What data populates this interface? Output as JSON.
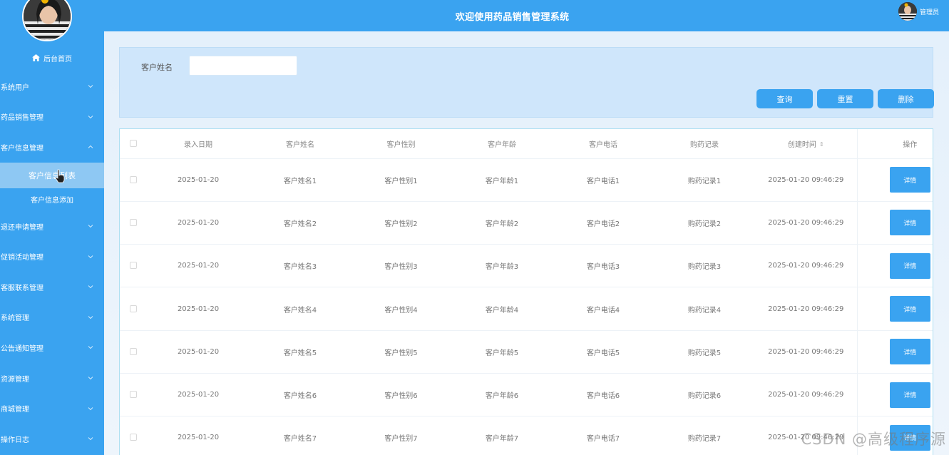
{
  "header": {
    "title": "欢迎使用药品销售管理系统",
    "user_label": "管理员"
  },
  "sidebar": {
    "home_label": "后台首页",
    "items": [
      {
        "label": "系统用户",
        "expanded": false
      },
      {
        "label": "药品销售管理",
        "expanded": false
      },
      {
        "label": "客户信息管理",
        "expanded": true,
        "children": [
          {
            "label": "客户信息列表",
            "active": true
          },
          {
            "label": "客户信息添加",
            "active": false
          }
        ]
      },
      {
        "label": "退还申请管理",
        "expanded": false
      },
      {
        "label": "促销活动管理",
        "expanded": false
      },
      {
        "label": "客服联系管理",
        "expanded": false
      },
      {
        "label": "系统管理",
        "expanded": false
      },
      {
        "label": "公告通知管理",
        "expanded": false
      },
      {
        "label": "资源管理",
        "expanded": false
      },
      {
        "label": "商城管理",
        "expanded": false
      },
      {
        "label": "操作日志",
        "expanded": false
      }
    ]
  },
  "search": {
    "label": "客户姓名",
    "value": "",
    "placeholder": "",
    "query_label": "查询",
    "reset_label": "重置",
    "delete_label": "删除"
  },
  "table": {
    "columns": [
      "录入日期",
      "客户姓名",
      "客户性别",
      "客户年龄",
      "客户电话",
      "购药记录",
      "创建时间",
      "操作"
    ],
    "sort_icon": "sort-icon",
    "action_label": "详情",
    "rows": [
      {
        "date": "2025-01-20",
        "name": "客户姓名1",
        "sex": "客户性别1",
        "age": "客户年龄1",
        "phone": "客户电话1",
        "record": "购药记录1",
        "created": "2025-01-20 09:46:29"
      },
      {
        "date": "2025-01-20",
        "name": "客户姓名2",
        "sex": "客户性别2",
        "age": "客户年龄2",
        "phone": "客户电话2",
        "record": "购药记录2",
        "created": "2025-01-20 09:46:29"
      },
      {
        "date": "2025-01-20",
        "name": "客户姓名3",
        "sex": "客户性别3",
        "age": "客户年龄3",
        "phone": "客户电话3",
        "record": "购药记录3",
        "created": "2025-01-20 09:46:29"
      },
      {
        "date": "2025-01-20",
        "name": "客户姓名4",
        "sex": "客户性别4",
        "age": "客户年龄4",
        "phone": "客户电话4",
        "record": "购药记录4",
        "created": "2025-01-20 09:46:29"
      },
      {
        "date": "2025-01-20",
        "name": "客户姓名5",
        "sex": "客户性别5",
        "age": "客户年龄5",
        "phone": "客户电话5",
        "record": "购药记录5",
        "created": "2025-01-20 09:46:29"
      },
      {
        "date": "2025-01-20",
        "name": "客户姓名6",
        "sex": "客户性别6",
        "age": "客户年龄6",
        "phone": "客户电话6",
        "record": "购药记录6",
        "created": "2025-01-20 09:46:29"
      },
      {
        "date": "2025-01-20",
        "name": "客户姓名7",
        "sex": "客户性别7",
        "age": "客户年龄7",
        "phone": "客户电话7",
        "record": "购药记录7",
        "created": "2025-01-20 09:46:29"
      }
    ]
  },
  "watermark": "CSDN @高级程序源",
  "colors": {
    "primary": "#3aa3f0",
    "active_submenu": "#8ec8f3",
    "search_panel": "#cfe6fb"
  }
}
